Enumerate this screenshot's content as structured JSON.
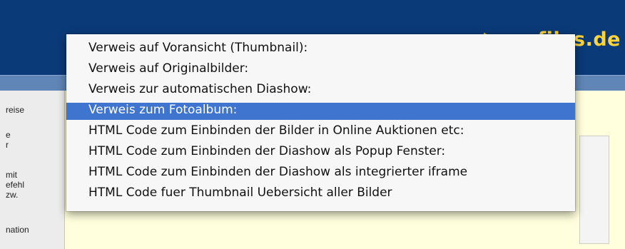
{
  "logo": {
    "text": "my-files.de"
  },
  "left_panel": {
    "items": [
      "reise",
      "e\nr",
      "mit\nefehl\nzw.",
      "nation"
    ]
  },
  "menu": {
    "items": [
      {
        "label": "Verweis auf Voransicht (Thumbnail):",
        "selected": false
      },
      {
        "label": "Verweis auf Originalbilder:",
        "selected": false
      },
      {
        "label": "Verweis zur automatischen Diashow:",
        "selected": false
      },
      {
        "label": "Verweis zum Fotoalbum:",
        "selected": true
      },
      {
        "label": "HTML Code zum Einbinden der Bilder in Online Auktionen etc:",
        "selected": false
      },
      {
        "label": "HTML Code zum Einbinden der Diashow als Popup Fenster:",
        "selected": false
      },
      {
        "label": "HTML Code zum Einbinden der Diashow als integrierter iframe",
        "selected": false
      },
      {
        "label": "HTML Code fuer Thumbnail Uebersicht aller Bilder",
        "selected": false
      }
    ]
  },
  "colors": {
    "header": "#0b3a78",
    "accent": "#ffd43b",
    "selection": "#3f74cf",
    "panel": "#ffffdd"
  }
}
